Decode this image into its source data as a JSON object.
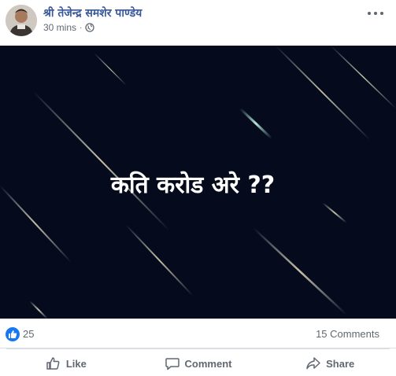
{
  "post": {
    "author": "श्री तेजेन्द्र समशेर पाण्डेय",
    "time": "30 mins",
    "separator": "·",
    "privacy_icon": "globe-icon",
    "more_icon": "more-options-icon",
    "image_text": "कति करोड अरे ??",
    "image_bg": "#050b1c"
  },
  "reactions": {
    "icon": "thumbs-up-icon",
    "count": "25",
    "comments": "15 Comments",
    "accent": "#1877f2"
  },
  "actions": {
    "like_label": "Like",
    "comment_label": "Comment",
    "share_label": "Share"
  }
}
